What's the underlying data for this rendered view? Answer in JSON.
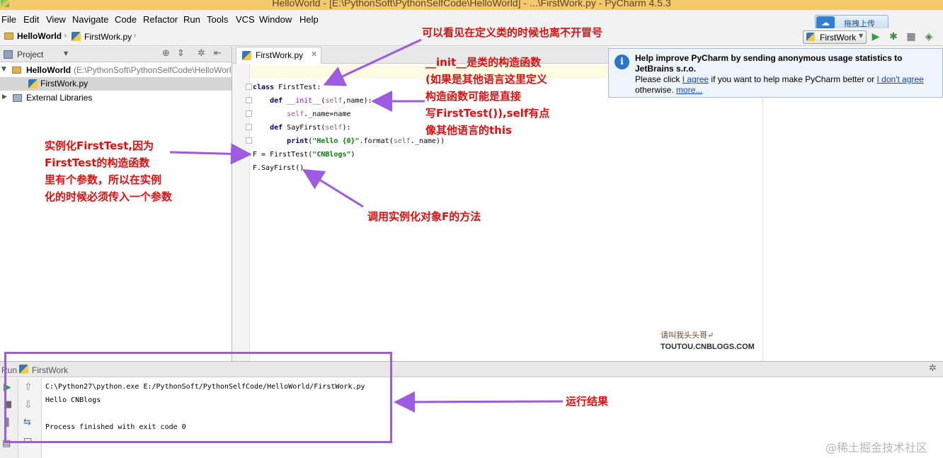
{
  "window": {
    "title": "HelloWorld - [E:\\PythonSoft\\PythonSelfCode\\HelloWorld] - ...\\FirstWork.py - PyCharm 4.5.3"
  },
  "menu": [
    "File",
    "Edit",
    "View",
    "Navigate",
    "Code",
    "Refactor",
    "Run",
    "Tools",
    "VCS",
    "Window",
    "Help"
  ],
  "upload_widget": {
    "label": "拖拽上传"
  },
  "breadcrumb": {
    "project": "HelloWorld",
    "file": "FirstWork.py"
  },
  "toolbar": {
    "run_config": "FirstWork"
  },
  "project_panel": {
    "title": "Project",
    "root_name": "HelloWorld",
    "root_path": "(E:\\PythonSoft\\PythonSelfCode\\HelloWorl",
    "file": "FirstWork.py",
    "external": "External Libraries"
  },
  "editor": {
    "tab": "FirstWork.py"
  },
  "notification": {
    "title_line1": "Help improve PyCharm by sending anonymous usage statistics to",
    "title_line2": "JetBrains s.r.o.",
    "text1": "Please click ",
    "link_agree": "I agree",
    "text2": " if you want to help make PyCharm better or ",
    "link_disagree": "I don't agree",
    "text3": "otherwise. ",
    "link_more": "more..."
  },
  "run_panel": {
    "label": "Run",
    "config": "FirstWork",
    "output": [
      "C:\\Python27\\python.exe E:/PythonSoft/PythonSelfCode/HelloWorld/FirstWork.py",
      "Hello CNBlogs",
      "",
      "Process finished with exit code 0"
    ]
  },
  "annotations": {
    "colon": "可以看见在定义类的时候也离不开冒号",
    "init": [
      "__init__是类的构造函数",
      "(如果是其他语言这里定义",
      "构造函数可能是直接",
      "写FirstTest()),self有点",
      "像其他语言的this"
    ],
    "instance": [
      "实例化FirstTest,因为",
      "FirstTest的构造函数",
      "里有个参数，所以在实例",
      "化的时候必须传入一个参数"
    ],
    "call": "调用实例化对象F的方法",
    "result": "运行结果"
  },
  "watermark": {
    "cn": "请叫我头头哥↵",
    "en": "TOUTOU.CNBLOGS.COM",
    "site": "@稀土掘金技术社区"
  }
}
